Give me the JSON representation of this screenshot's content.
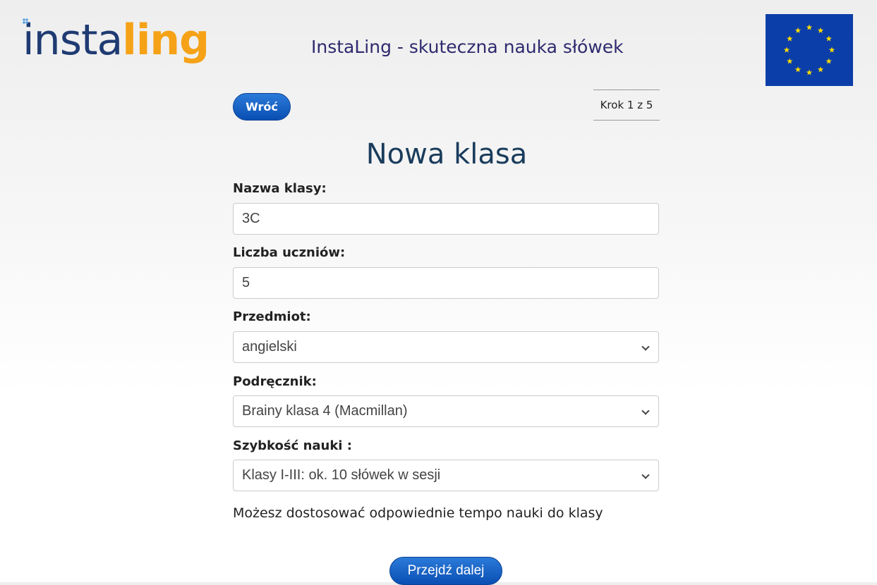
{
  "header": {
    "logo_part1": "insta",
    "logo_part2": "ling",
    "site_title": "InstaLing - skuteczna nauka słówek"
  },
  "nav": {
    "back_label": "Wróć",
    "step_label": "Krok 1 z 5"
  },
  "form": {
    "title": "Nowa klasa",
    "class_name_label": "Nazwa klasy:",
    "class_name_value": "3C",
    "students_label": "Liczba uczniów:",
    "students_value": "5",
    "subject_label": "Przedmiot:",
    "subject_value": "angielski",
    "textbook_label": "Podręcznik:",
    "textbook_value": "Brainy klasa 4 (Macmillan)",
    "speed_label": "Szybkość nauki :",
    "speed_value": "Klasy I-III: ok. 10 słówek w sesji",
    "hint": "Możesz dostosować odpowiednie tempo nauki do klasy",
    "next_label": "Przejdź dalej"
  },
  "colors": {
    "logo_dark": "#1f3b73",
    "logo_accent": "#f5a217",
    "button_blue": "#0a4fb4",
    "eu_blue": "#0b3ea8",
    "eu_star": "#ffdd00"
  },
  "icons": [
    "eu-flag-icon",
    "chevron-down-icon"
  ]
}
